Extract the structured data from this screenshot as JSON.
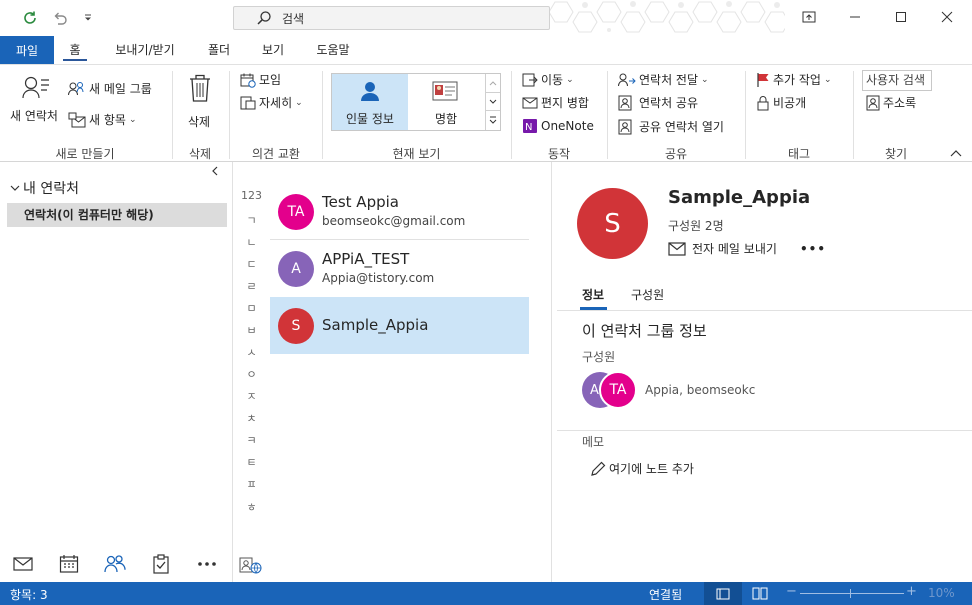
{
  "titlebar": {
    "search_label": "검색",
    "icons": [
      "refresh-icon",
      "undo-icon",
      "customize-qat-icon",
      "ribbon-display-icon",
      "minimize-icon",
      "maximize-icon",
      "close-icon"
    ]
  },
  "tabs": [
    "파일",
    "홈",
    "보내기/받기",
    "폴더",
    "보기",
    "도움말"
  ],
  "ribbon": {
    "new_contact": "새 연락처",
    "new_email_group": "새 메일 그룹",
    "new_items": "새 항목",
    "group_new": "새로 만들기",
    "delete": "삭제",
    "group_delete": "삭제",
    "meeting": "모임",
    "more": "자세히",
    "group_respond": "의견 교환",
    "view_people": "인물 정보",
    "view_card": "명함",
    "group_current_view": "현재 보기",
    "move": "이동",
    "mail_merge": "편지 병합",
    "onenote": "OneNote",
    "group_actions": "동작",
    "forward_contact": "연락처 전달",
    "share_contacts": "연락처 공유",
    "open_shared_contacts": "공유 연락처 열기",
    "group_share": "공유",
    "follow_up": "추가 작업",
    "private": "비공개",
    "group_tags": "태그",
    "search_people_placeholder": "사용자 검색",
    "address_book": "주소록",
    "group_find": "찾기"
  },
  "left_pane": {
    "section_title": "내 연락처",
    "folder_item": "연락처(이 컴퓨터만 해당)"
  },
  "alpha_index": [
    "123",
    "ㄱ",
    "ㄴ",
    "ㄷ",
    "ㄹ",
    "ㅁ",
    "ㅂ",
    "ㅅ",
    "ㅇ",
    "ㅈ",
    "ㅊ",
    "ㅋ",
    "ㅌ",
    "ㅍ",
    "ㅎ"
  ],
  "contacts": [
    {
      "initials": "TA",
      "name": "Test Appia",
      "email": "beomseokc@gmail.com",
      "color": "#e3008c"
    },
    {
      "initials": "A",
      "name": "APPiA_TEST",
      "email": "Appia@tistory.com",
      "color": "#8764b8"
    },
    {
      "initials": "S",
      "name": "Sample_Appia",
      "email": "",
      "color": "#d13438"
    }
  ],
  "detail": {
    "initial": "S",
    "name": "Sample_Appia",
    "member_count": "구성원 2명",
    "send_email": "전자 메일 보내기",
    "more": "•••",
    "tab_info": "정보",
    "tab_members": "구성원",
    "group_info_title": "이 연락처 그룹 정보",
    "members_label": "구성원",
    "member_back_initial": "A",
    "member_front_initial": "TA",
    "member_names": "Appia, beomseokc",
    "memo_label": "메모",
    "add_note": "여기에 노트 추가"
  },
  "status": {
    "items_count": "항목: 3",
    "connection": "연결됨",
    "zoom_minus": "−",
    "zoom_plus": "+",
    "zoom": "10%"
  },
  "colors": {
    "brand_blue": "#1a64b8",
    "selected_item": "#cce4f7"
  }
}
